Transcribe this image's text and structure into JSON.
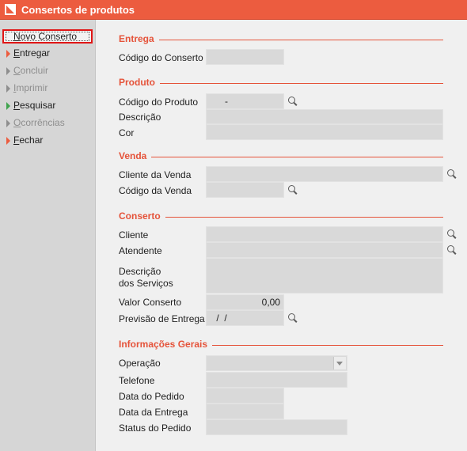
{
  "window": {
    "title": "Consertos de produtos"
  },
  "sidebar": {
    "items": [
      {
        "label": "Novo Conserto"
      },
      {
        "label": "Entregar"
      },
      {
        "label": "Concluir"
      },
      {
        "label": "Imprimir"
      },
      {
        "label": "Pesquisar"
      },
      {
        "label": "Ocorrências"
      },
      {
        "label": "Fechar"
      }
    ]
  },
  "entrega": {
    "title": "Entrega",
    "codigo_label": "Código do Conserto",
    "codigo_value": ""
  },
  "produto": {
    "title": "Produto",
    "codigo_label": "Código do Produto",
    "codigo_value": "-",
    "descricao_label": "Descrição",
    "descricao_value": "",
    "cor_label": "Cor",
    "cor_value": ""
  },
  "venda": {
    "title": "Venda",
    "cliente_label": "Cliente da Venda",
    "cliente_value": "",
    "codigo_label": "Código da Venda",
    "codigo_value": ""
  },
  "conserto": {
    "title": "Conserto",
    "cliente_label": "Cliente",
    "cliente_value": "",
    "atendente_label": "Atendente",
    "atendente_value": "",
    "descricao_label_1": "Descrição",
    "descricao_label_2": "dos Serviços",
    "descricao_value": "",
    "valor_label": "Valor Conserto",
    "valor_value": "0,00",
    "previsao_label": "Previsão de Entrega",
    "previsao_value": " /  /"
  },
  "info": {
    "title": "Informações Gerais",
    "operacao_label": "Operação",
    "operacao_value": "",
    "telefone_label": "Telefone",
    "telefone_value": "",
    "data_pedido_label": "Data do Pedido",
    "data_pedido_value": "",
    "data_entrega_label": "Data da Entrega",
    "data_entrega_value": "",
    "status_label": "Status do Pedido",
    "status_value": ""
  },
  "icons": {
    "search": "magnifier-icon",
    "dropdown": "chevron-down-icon",
    "bullet": "triangle-bullet-icon"
  },
  "colors": {
    "accent": "#ec5c3f",
    "section": "#e5533a",
    "field_bg": "#d9d9d9",
    "sidebar_bg": "#d6d6d6",
    "focus": "#e01616",
    "green_bullet": "#3fa34d",
    "disabled": "#8e8e8e"
  }
}
